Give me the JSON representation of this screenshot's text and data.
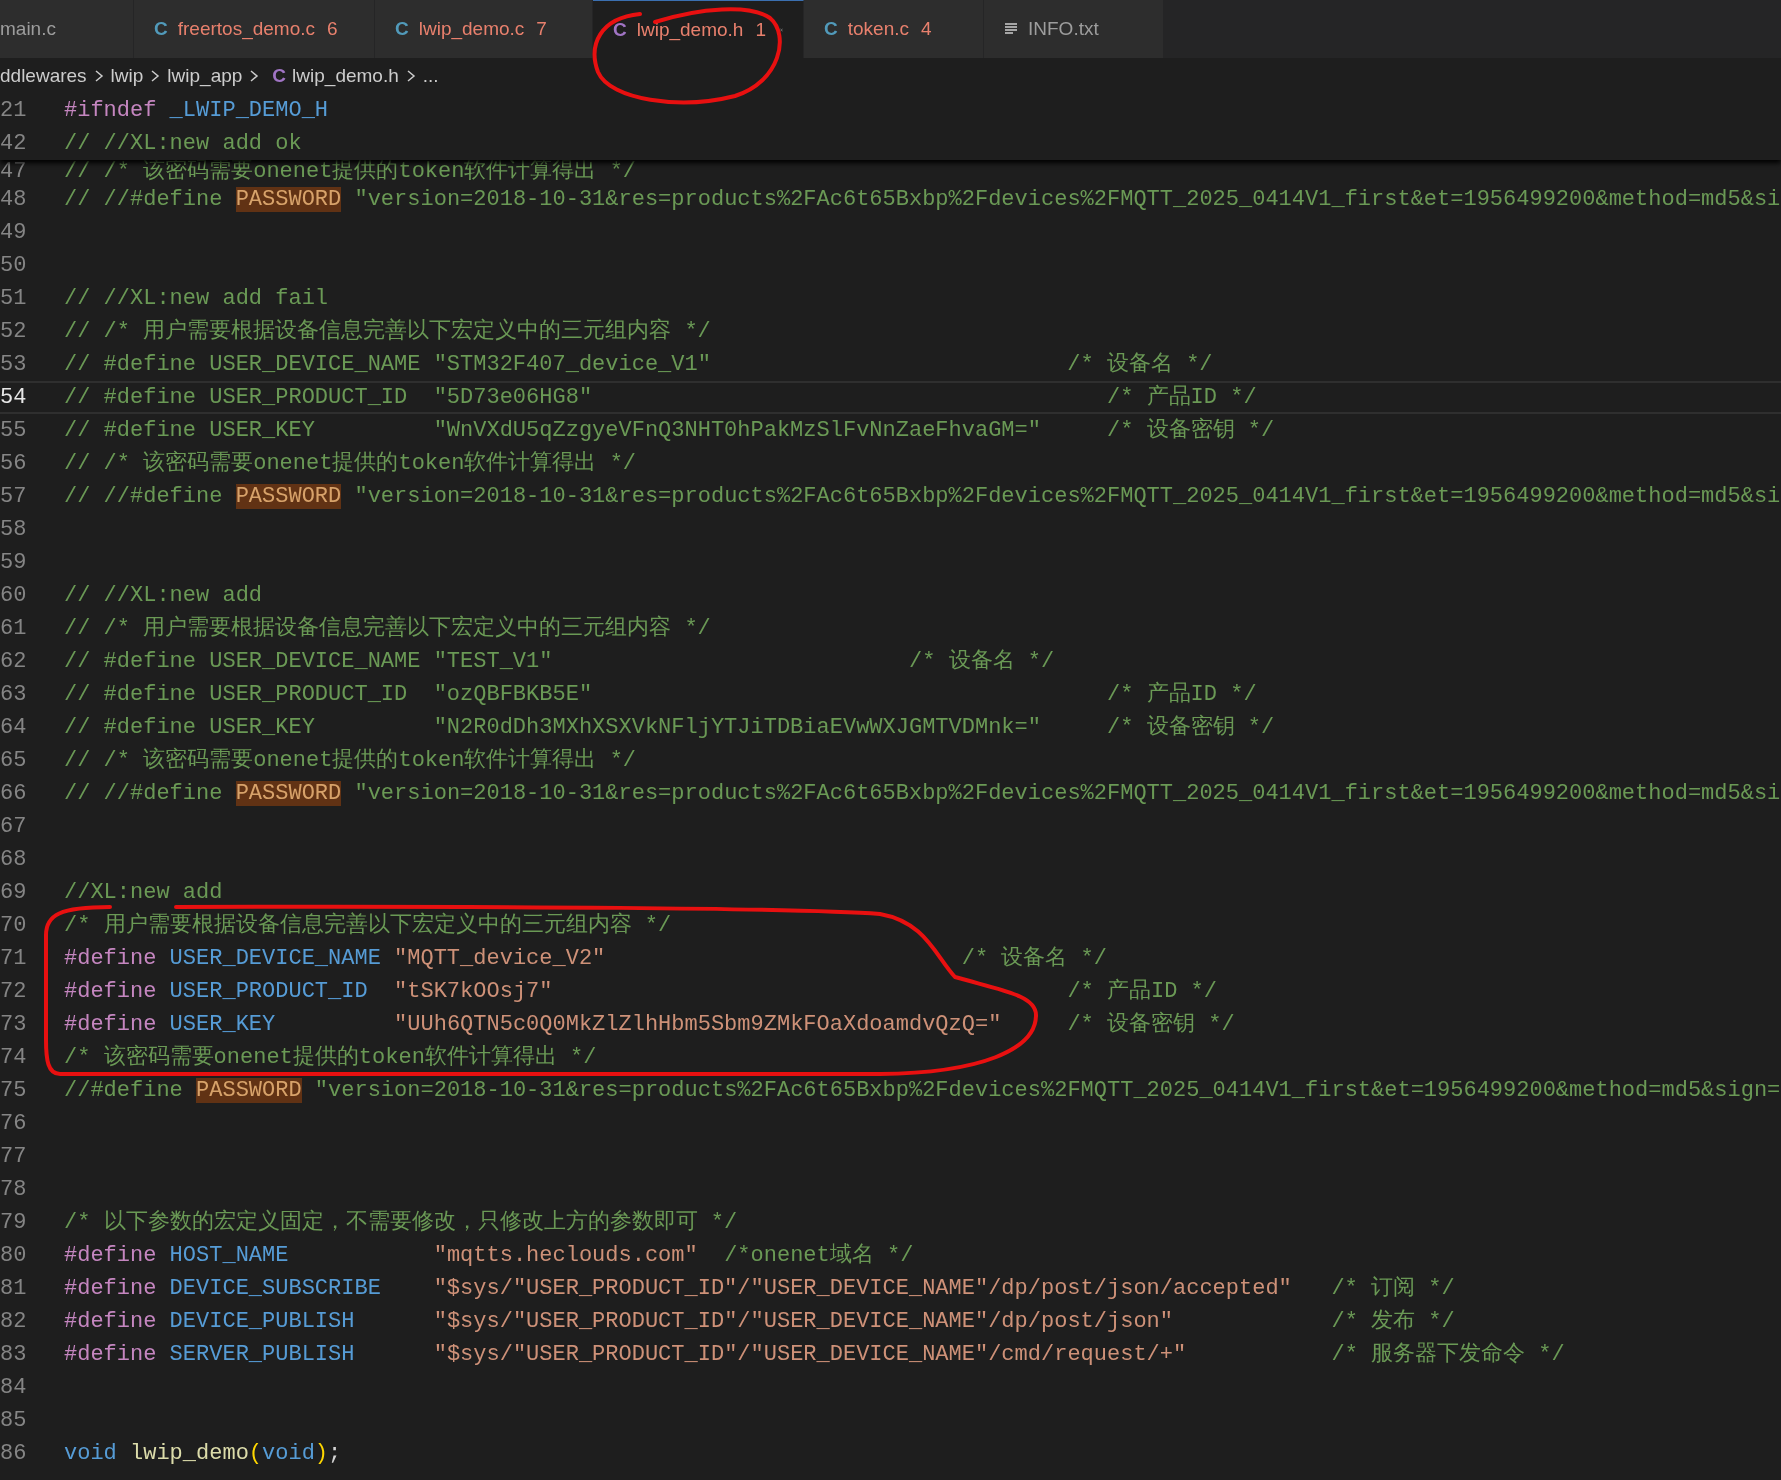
{
  "tabs": [
    {
      "kind": "plain",
      "label": "main.c",
      "selected": false
    },
    {
      "kind": "c",
      "icon": "C",
      "color": "#519aba",
      "label": "freertos_demo.c",
      "problems": "6",
      "selected": false
    },
    {
      "kind": "c",
      "icon": "C",
      "color": "#519aba",
      "label": "lwip_demo.c",
      "problems": "7",
      "selected": false
    },
    {
      "kind": "c",
      "icon": "C",
      "color": "#a074c4",
      "label": "lwip_demo.h",
      "problems": "1",
      "selected": true
    },
    {
      "kind": "c",
      "icon": "C",
      "color": "#519aba",
      "label": "token.c",
      "problems": "4",
      "selected": false
    },
    {
      "kind": "text",
      "label": "INFO.txt",
      "selected": false
    }
  ],
  "breadcrumbs": [
    {
      "label": "ddlewares"
    },
    {
      "label": "lwip"
    },
    {
      "label": "lwip_app"
    },
    {
      "label": "lwip_demo.h",
      "icon": "C",
      "color": "#a074c4"
    },
    {
      "label": "..."
    }
  ],
  "sticky_lines": [
    {
      "number": "21",
      "segments": [
        {
          "kind": "directive",
          "t": "#ifndef"
        },
        {
          "kind": "macro",
          "t": " _LWIP_DEMO_H"
        }
      ]
    },
    {
      "number": "42",
      "segments": [
        {
          "kind": "comment",
          "t": "// //XL:new add ok"
        }
      ]
    }
  ],
  "lines": [
    {
      "number": "47",
      "current": false,
      "segments": [
        {
          "kind": "comment",
          "t": "// /* 该密码需要onenet提供的token软件计算得出 */"
        }
      ]
    },
    {
      "number": "48",
      "current": false,
      "segments": [
        {
          "kind": "comment",
          "t": "// //#define "
        },
        {
          "kind": "highlight",
          "t": "PASSWORD"
        },
        {
          "kind": "comment",
          "t": " \"version=2018-10-31&res=products%2FAc6t65Bxbp%2Fdevices%2FMQTT_2025_0414V1_first&et=1956499200&method=md5&si"
        }
      ]
    },
    {
      "number": "49",
      "current": false
    },
    {
      "number": "50",
      "current": false
    },
    {
      "number": "51",
      "current": false,
      "segments": [
        {
          "kind": "comment",
          "t": "// //XL:new add fail"
        }
      ]
    },
    {
      "number": "52",
      "current": false,
      "segments": [
        {
          "kind": "comment",
          "t": "// /* 用户需要根据设备信息完善以下宏定义中的三元组内容 */"
        }
      ]
    },
    {
      "number": "53",
      "current": false,
      "segments": [
        {
          "kind": "comment",
          "t": "// #define USER_DEVICE_NAME \"STM32F407_device_V1\"                           /* 设备名 */"
        }
      ]
    },
    {
      "number": "54",
      "current": true,
      "segments": [
        {
          "kind": "comment",
          "t": "// #define USER_PRODUCT_ID  \"5D73e06HG8\"                                       /* 产品ID */"
        }
      ]
    },
    {
      "number": "55",
      "current": false,
      "segments": [
        {
          "kind": "comment",
          "t": "// #define USER_KEY         \"WnVXdU5qZzgyeVFnQ3NHT0hPakMzSlFvNnZaeFhvaGM=\"     /* 设备密钥 */"
        }
      ]
    },
    {
      "number": "56",
      "current": false,
      "segments": [
        {
          "kind": "comment",
          "t": "// /* 该密码需要onenet提供的token软件计算得出 */"
        }
      ]
    },
    {
      "number": "57",
      "current": false,
      "segments": [
        {
          "kind": "comment",
          "t": "// //#define "
        },
        {
          "kind": "highlight",
          "t": "PASSWORD"
        },
        {
          "kind": "comment",
          "t": " \"version=2018-10-31&res=products%2FAc6t65Bxbp%2Fdevices%2FMQTT_2025_0414V1_first&et=1956499200&method=md5&si"
        }
      ]
    },
    {
      "number": "58",
      "current": false
    },
    {
      "number": "59",
      "current": false
    },
    {
      "number": "60",
      "current": false,
      "segments": [
        {
          "kind": "comment",
          "t": "// //XL:new add"
        }
      ]
    },
    {
      "number": "61",
      "current": false,
      "segments": [
        {
          "kind": "comment",
          "t": "// /* 用户需要根据设备信息完善以下宏定义中的三元组内容 */"
        }
      ]
    },
    {
      "number": "62",
      "current": false,
      "segments": [
        {
          "kind": "comment",
          "t": "// #define USER_DEVICE_NAME \"TEST_V1\"                           /* 设备名 */"
        }
      ]
    },
    {
      "number": "63",
      "current": false,
      "segments": [
        {
          "kind": "comment",
          "t": "// #define USER_PRODUCT_ID  \"ozQBFBKB5E\"                                       /* 产品ID */"
        }
      ]
    },
    {
      "number": "64",
      "current": false,
      "segments": [
        {
          "kind": "comment",
          "t": "// #define USER_KEY         \"N2R0dDh3MXhXSXVkNFljYTJiTDBiaEVwWXJGMTVDMnk=\"     /* 设备密钥 */"
        }
      ]
    },
    {
      "number": "65",
      "current": false,
      "segments": [
        {
          "kind": "comment",
          "t": "// /* 该密码需要onenet提供的token软件计算得出 */"
        }
      ]
    },
    {
      "number": "66",
      "current": false,
      "segments": [
        {
          "kind": "comment",
          "t": "// //#define "
        },
        {
          "kind": "highlight",
          "t": "PASSWORD"
        },
        {
          "kind": "comment",
          "t": " \"version=2018-10-31&res=products%2FAc6t65Bxbp%2Fdevices%2FMQTT_2025_0414V1_first&et=1956499200&method=md5&si"
        }
      ]
    },
    {
      "number": "67",
      "current": false
    },
    {
      "number": "68",
      "current": false
    },
    {
      "number": "69",
      "current": false,
      "segments": [
        {
          "kind": "comment",
          "t": "//XL:new add"
        }
      ]
    },
    {
      "number": "70",
      "current": false,
      "segments": [
        {
          "kind": "comment",
          "t": "/* 用户需要根据设备信息完善以下宏定义中的三元组内容 */"
        }
      ]
    },
    {
      "number": "71",
      "current": false,
      "segments": [
        {
          "kind": "directive",
          "t": "#define"
        },
        {
          "kind": "macro",
          "t": " USER_DEVICE_NAME"
        },
        {
          "kind": "string",
          "t": " \"MQTT_device_V2\""
        },
        {
          "kind": "comment",
          "t": "                           /* 设备名 */"
        }
      ]
    },
    {
      "number": "72",
      "current": false,
      "segments": [
        {
          "kind": "directive",
          "t": "#define"
        },
        {
          "kind": "macro",
          "t": " USER_PRODUCT_ID"
        },
        {
          "kind": "string",
          "t": "  \"tSK7kOOsj7\""
        },
        {
          "kind": "comment",
          "t": "                                       /* 产品ID */"
        }
      ]
    },
    {
      "number": "73",
      "current": false,
      "segments": [
        {
          "kind": "directive",
          "t": "#define"
        },
        {
          "kind": "macro",
          "t": " USER_KEY"
        },
        {
          "kind": "string",
          "t": "         \"UUh6QTN5c0Q0MkZlZlhHbm5Sbm9ZMkFOaXdoamdvQzQ=\""
        },
        {
          "kind": "comment",
          "t": "     /* 设备密钥 */"
        }
      ]
    },
    {
      "number": "74",
      "current": false,
      "segments": [
        {
          "kind": "comment",
          "t": "/* 该密码需要onenet提供的token软件计算得出 */"
        }
      ]
    },
    {
      "number": "75",
      "current": false,
      "segments": [
        {
          "kind": "comment",
          "t": "//#define "
        },
        {
          "kind": "highlight",
          "t": "PASSWORD"
        },
        {
          "kind": "comment",
          "t": " \"version=2018-10-31&res=products%2FAc6t65Bxbp%2Fdevices%2FMQTT_2025_0414V1_first&et=1956499200&method=md5&sign="
        }
      ]
    },
    {
      "number": "76",
      "current": false
    },
    {
      "number": "77",
      "current": false
    },
    {
      "number": "78",
      "current": false
    },
    {
      "number": "79",
      "current": false,
      "segments": [
        {
          "kind": "comment",
          "t": "/* 以下参数的宏定义固定，不需要修改，只修改上方的参数即可 */"
        }
      ]
    },
    {
      "number": "80",
      "current": false,
      "segments": [
        {
          "kind": "directive",
          "t": "#define"
        },
        {
          "kind": "macro",
          "t": " HOST_NAME"
        },
        {
          "kind": "string",
          "t": "           \"mqtts.heclouds.com\""
        },
        {
          "kind": "comment",
          "t": "  /*onenet域名 */"
        }
      ]
    },
    {
      "number": "81",
      "current": false,
      "segments": [
        {
          "kind": "directive",
          "t": "#define"
        },
        {
          "kind": "macro",
          "t": " DEVICE_SUBSCRIBE"
        },
        {
          "kind": "string",
          "t": "    \"$sys/\"USER_PRODUCT_ID\"/\"USER_DEVICE_NAME\"/dp/post/json/accepted\""
        },
        {
          "kind": "comment",
          "t": "   /* 订阅 */"
        }
      ]
    },
    {
      "number": "82",
      "current": false,
      "segments": [
        {
          "kind": "directive",
          "t": "#define"
        },
        {
          "kind": "macro",
          "t": " DEVICE_PUBLISH"
        },
        {
          "kind": "string",
          "t": "      \"$sys/\"USER_PRODUCT_ID\"/\"USER_DEVICE_NAME\"/dp/post/json\""
        },
        {
          "kind": "comment",
          "t": "            /* 发布 */"
        }
      ]
    },
    {
      "number": "83",
      "current": false,
      "segments": [
        {
          "kind": "directive",
          "t": "#define"
        },
        {
          "kind": "macro",
          "t": " SERVER_PUBLISH"
        },
        {
          "kind": "string",
          "t": "      \"$sys/\"USER_PRODUCT_ID\"/\"USER_DEVICE_NAME\"/cmd/request/+\""
        },
        {
          "kind": "comment",
          "t": "           /* 服务器下发命令 */"
        }
      ]
    },
    {
      "number": "84",
      "current": false
    },
    {
      "number": "85",
      "current": false
    },
    {
      "number": "86",
      "current": false,
      "segments": [
        {
          "kind": "keyword",
          "t": "void"
        },
        {
          "kind": "function",
          "t": " lwip_demo"
        },
        {
          "kind": "bracket",
          "t": "("
        },
        {
          "kind": "keyword",
          "t": "void"
        },
        {
          "kind": "bracket",
          "t": ")"
        },
        {
          "kind": "plain",
          "t": ";"
        }
      ]
    }
  ]
}
